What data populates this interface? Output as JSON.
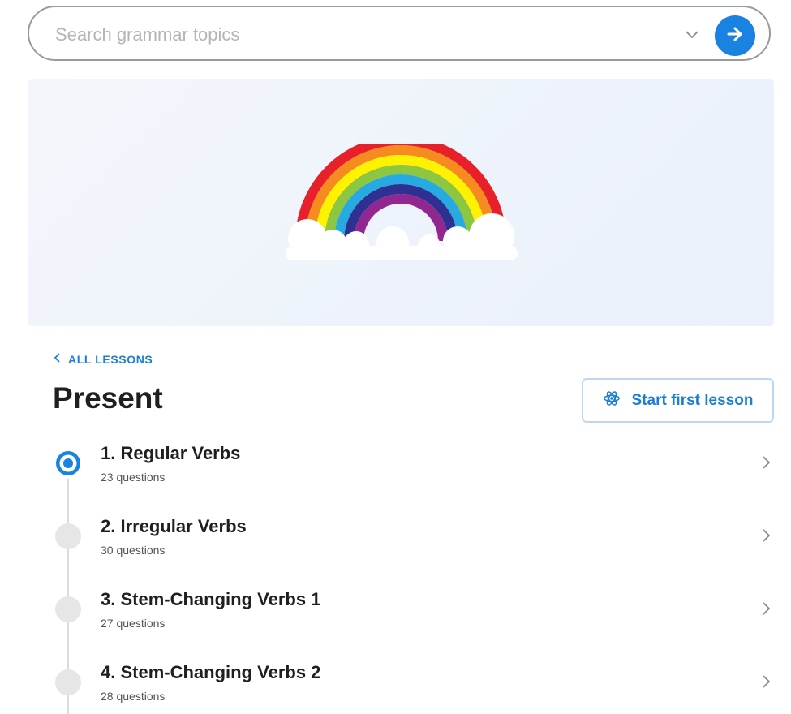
{
  "search": {
    "placeholder": "Search grammar topics",
    "value": ""
  },
  "nav": {
    "back_label": "ALL LESSONS"
  },
  "page": {
    "title": "Present"
  },
  "actions": {
    "start_label": "Start first lesson"
  },
  "lessons": [
    {
      "title": "1. Regular Verbs",
      "count": "23 questions",
      "active": true
    },
    {
      "title": "2. Irregular Verbs",
      "count": "30 questions",
      "active": false
    },
    {
      "title": "3. Stem-Changing Verbs 1",
      "count": "27 questions",
      "active": false
    },
    {
      "title": "4. Stem-Changing Verbs 2",
      "count": "28 questions",
      "active": false
    }
  ],
  "colors": {
    "accent": "#1a83e2",
    "link": "#1a7fd4",
    "marker_inactive": "#e6e6e6"
  },
  "icons": {
    "dropdown": "chevron-down-icon",
    "submit": "arrow-right-icon",
    "back": "chevron-left-icon",
    "start": "atom-icon",
    "lesson_open": "chevron-right-icon",
    "banner": "rainbow-illustration"
  }
}
